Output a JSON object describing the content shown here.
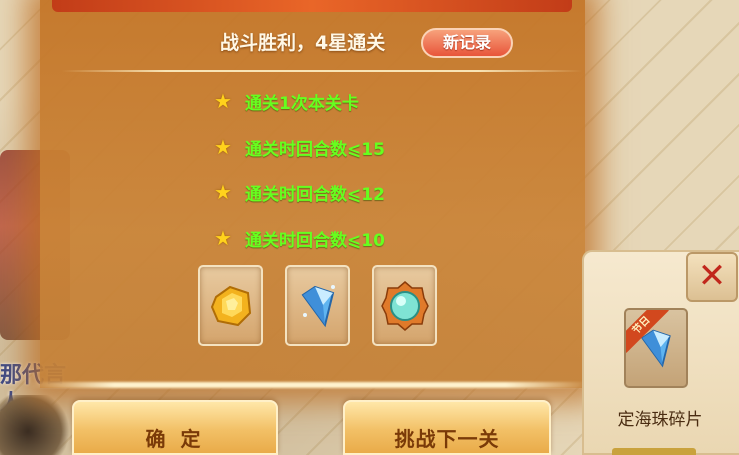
{
  "header": {
    "title": "战斗胜利，4星通关",
    "badge": "新记录"
  },
  "conditions": [
    {
      "text": "通关1次本关卡",
      "star": "★"
    },
    {
      "text": "通关时回合数⩽15",
      "star": "★"
    },
    {
      "text": "通关时回合数⩽12",
      "star": "★"
    },
    {
      "text": "通关时回合数⩽10",
      "star": "★"
    }
  ],
  "rewards": [
    {
      "icon": "gold-gem-icon"
    },
    {
      "icon": "blue-crystal-shard-icon"
    },
    {
      "icon": "cyan-orb-icon"
    }
  ],
  "buttons": {
    "confirm": "确 定",
    "next": "挑战下一关"
  },
  "side_panel": {
    "close": "✕",
    "item_badge": "节日",
    "item_name": "定海珠碎片"
  },
  "background_text": "那代言人\n艺兴",
  "colors": {
    "panel": "#c98038",
    "condition_text": "#66ff1f",
    "star": "#ffd21c",
    "badge": "#e8553a",
    "button_text": "#7a3a08",
    "close": "#c1271c"
  }
}
